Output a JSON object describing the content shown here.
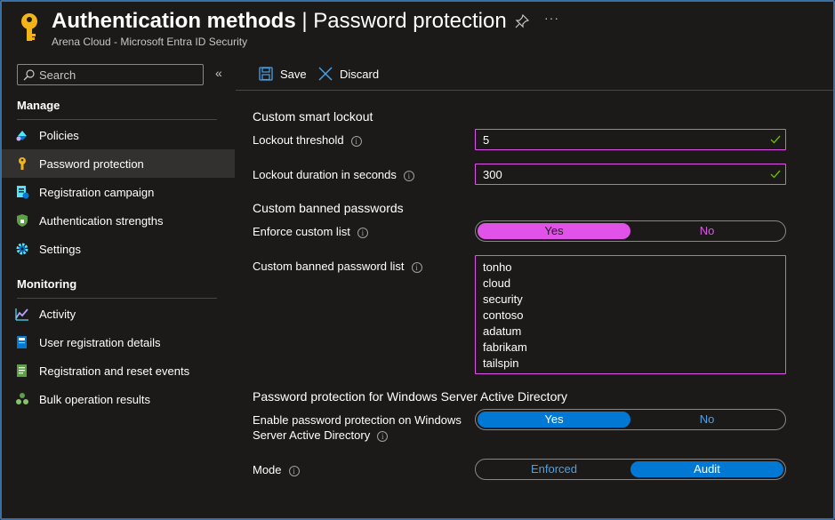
{
  "header": {
    "title_bold": "Authentication methods",
    "title_separator": " | ",
    "title_rest": "Password protection",
    "subtitle": "Arena Cloud - Microsoft Entra ID Security",
    "more": "···"
  },
  "sidebar": {
    "search_placeholder": "Search",
    "collapse": "«",
    "manage_title": "Manage",
    "monitoring_title": "Monitoring",
    "manage_items": [
      {
        "label": "Policies",
        "icon": "policies-icon"
      },
      {
        "label": "Password protection",
        "icon": "key-icon",
        "active": true
      },
      {
        "label": "Registration campaign",
        "icon": "registration-icon"
      },
      {
        "label": "Authentication strengths",
        "icon": "shield-icon"
      },
      {
        "label": "Settings",
        "icon": "gear-icon"
      }
    ],
    "monitoring_items": [
      {
        "label": "Activity",
        "icon": "activity-chart-icon"
      },
      {
        "label": "User registration details",
        "icon": "user-details-icon"
      },
      {
        "label": "Registration and reset events",
        "icon": "events-icon"
      },
      {
        "label": "Bulk operation results",
        "icon": "bulk-icon"
      }
    ]
  },
  "toolbar": {
    "save_label": "Save",
    "discard_label": "Discard"
  },
  "form": {
    "smart_lockout_title": "Custom smart lockout",
    "lockout_threshold_label": "Lockout threshold",
    "lockout_threshold_value": "5",
    "lockout_duration_label": "Lockout duration in seconds",
    "lockout_duration_value": "300",
    "banned_title": "Custom banned passwords",
    "enforce_label": "Enforce custom list",
    "enforce_yes": "Yes",
    "enforce_no": "No",
    "enforce_selected": "Yes",
    "banned_list_label": "Custom banned password list",
    "banned_list": [
      "tonho",
      "cloud",
      "security",
      "contoso",
      "adatum",
      "fabrikam",
      "tailspin"
    ],
    "ad_title": "Password protection for Windows Server Active Directory",
    "enable_ad_label": "Enable password protection on Windows Server Active Directory",
    "enable_ad_yes": "Yes",
    "enable_ad_no": "No",
    "enable_ad_selected": "Yes",
    "mode_label": "Mode",
    "mode_enforced": "Enforced",
    "mode_audit": "Audit",
    "mode_selected": "Audit",
    "info_glyph": "i"
  },
  "colors": {
    "accent_blue": "#0078d4",
    "accent_magenta": "#e052e8",
    "key_yellow": "#f2b417",
    "check_green": "#6bb700"
  }
}
